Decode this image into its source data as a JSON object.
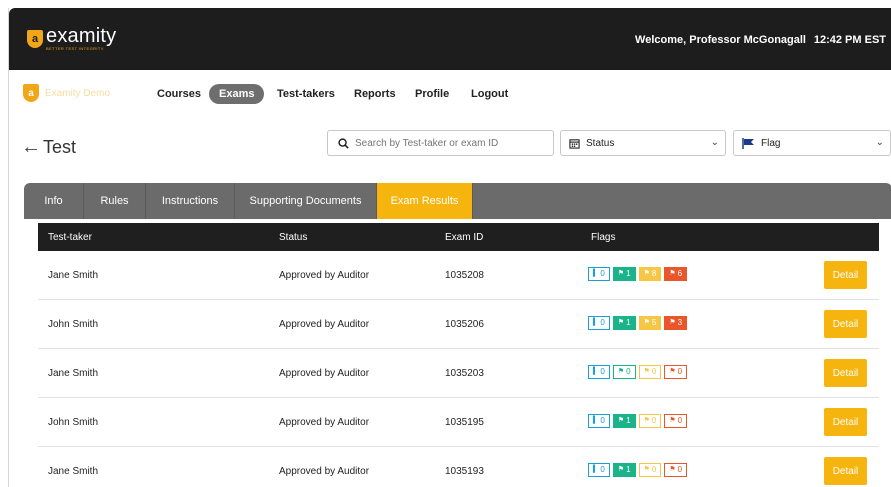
{
  "header": {
    "logo_text": "examity",
    "logo_tagline": "BETTER TEST INTEGRITY.",
    "welcome": "Welcome, Professor McGonagall",
    "time": "12:42 PM  EST"
  },
  "nav": {
    "brand": "Examity Demo",
    "items": [
      "Courses",
      "Exams",
      "Test-takers",
      "Reports",
      "Profile",
      "Logout"
    ],
    "active": "Exams"
  },
  "page": {
    "title": "Test",
    "search_placeholder": "Search by Test-taker or exam ID",
    "status_label": "Status",
    "flag_label": "Flag"
  },
  "tabs": [
    "Info",
    "Rules",
    "Instructions",
    "Supporting Documents",
    "Exam Results"
  ],
  "active_tab": "Exam Results",
  "table": {
    "headers": [
      "Test-taker",
      "Status",
      "Exam ID",
      "Flags"
    ],
    "detail_label": "Detail",
    "rows": [
      {
        "name": "Jane Smith",
        "status": "Approved by Auditor",
        "exam_id": "1035208",
        "flags": [
          "0",
          "1",
          "8",
          "6"
        ],
        "filled": [
          false,
          true,
          true,
          true
        ]
      },
      {
        "name": "John Smith",
        "status": "Approved by Auditor",
        "exam_id": "1035206",
        "flags": [
          "0",
          "1",
          "5",
          "3"
        ],
        "filled": [
          false,
          true,
          true,
          true
        ]
      },
      {
        "name": "Jane Smith",
        "status": "Approved by Auditor",
        "exam_id": "1035203",
        "flags": [
          "0",
          "0",
          "0",
          "0"
        ],
        "filled": [
          false,
          false,
          false,
          false
        ]
      },
      {
        "name": "John Smith",
        "status": "Approved by Auditor",
        "exam_id": "1035195",
        "flags": [
          "0",
          "1",
          "0",
          "0"
        ],
        "filled": [
          false,
          true,
          false,
          false
        ]
      },
      {
        "name": "Jane Smith",
        "status": "Approved by Auditor",
        "exam_id": "1035193",
        "flags": [
          "0",
          "1",
          "0",
          "0"
        ],
        "filled": [
          false,
          true,
          false,
          false
        ]
      }
    ]
  },
  "colors": {
    "accent": "#f6b40e",
    "flag_blue": "#1aa0d8",
    "flag_green": "#1bb38a",
    "flag_yellow": "#f6c744",
    "flag_red": "#ea5529"
  }
}
